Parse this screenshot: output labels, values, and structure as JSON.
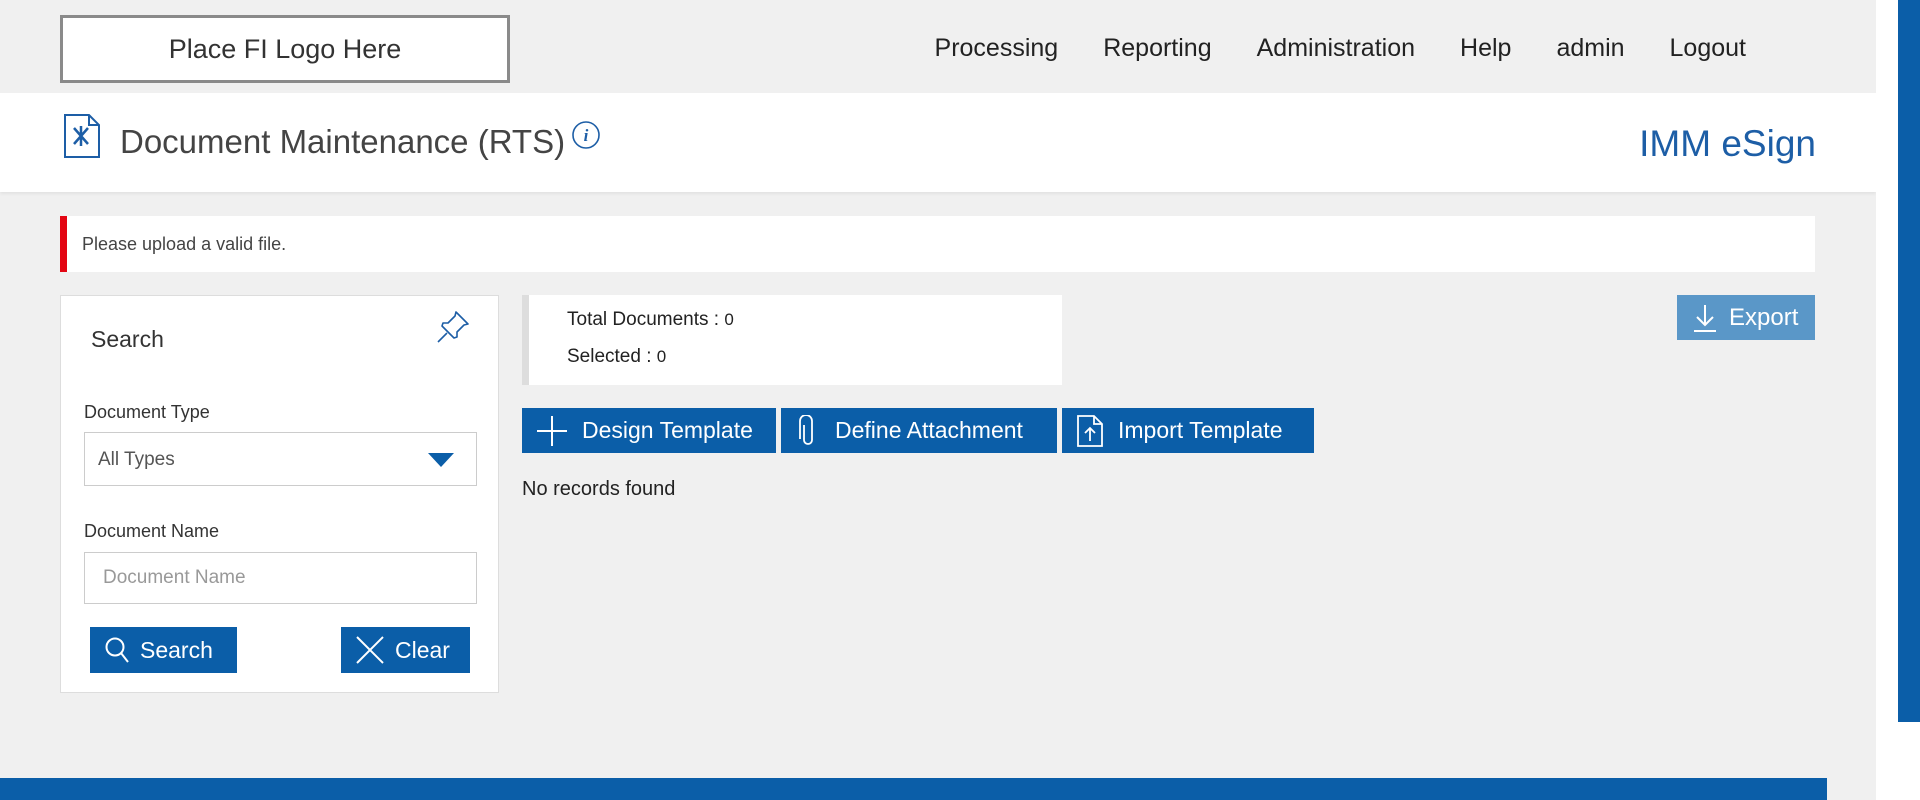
{
  "header": {
    "logo_text": "Place FI Logo Here",
    "nav": [
      "Processing",
      "Reporting",
      "Administration",
      "Help",
      "admin",
      "Logout"
    ]
  },
  "titlebar": {
    "page_title": "Document Maintenance (RTS)",
    "brand": "IMM eSign",
    "page_icon": "document-tools-icon",
    "info_icon": "info-icon"
  },
  "alert": {
    "message": "Please upload a valid file.",
    "accent_color": "#e30613"
  },
  "search": {
    "title": "Search",
    "document_type_label": "Document Type",
    "document_type_value": "All Types",
    "document_name_label": "Document Name",
    "document_name_placeholder": "Document Name",
    "search_button": "Search",
    "clear_button": "Clear"
  },
  "summary": {
    "total_label": "Total Documents : ",
    "total_value": "0",
    "selected_label": "Selected : ",
    "selected_value": "0"
  },
  "actions": {
    "export": "Export",
    "design_template": "Design Template",
    "define_attachment": "Define Attachment",
    "import_template": "Import Template"
  },
  "results": {
    "empty_message": "No records found"
  },
  "colors": {
    "primary": "#0b5ea8",
    "export": "#5a97c8",
    "brand": "#1d5ea6"
  }
}
